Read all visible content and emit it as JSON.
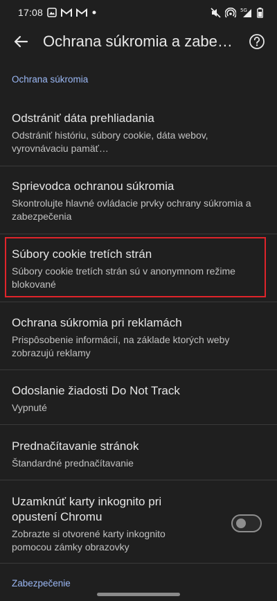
{
  "status_bar": {
    "time": "17:08",
    "signal_label": "5G"
  },
  "app_bar": {
    "title": "Ochrana súkromia a zabezpečenie"
  },
  "sections": {
    "privacy_header": "Ochrana súkromia",
    "security_header": "Zabezpečenie"
  },
  "items": [
    {
      "title": "Odstrániť dáta prehliadania",
      "subtitle": "Odstrániť históriu, súbory cookie, dáta webov, vyrovnávaciu pamäť…"
    },
    {
      "title": "Sprievodca ochranou súkromia",
      "subtitle": "Skontrolujte hlavné ovládacie prvky ochrany súkromia a zabezpečenia"
    },
    {
      "title": "Súbory cookie tretích strán",
      "subtitle": "Súbory cookie tretích strán sú v anonymnom režime blokované"
    },
    {
      "title": "Ochrana súkromia pri reklamách",
      "subtitle": "Prispôsobenie informácií, na základe ktorých weby zobrazujú reklamy"
    },
    {
      "title": "Odoslanie žiadosti Do Not Track",
      "subtitle": "Vypnuté"
    },
    {
      "title": "Prednačítavanie stránok",
      "subtitle": "Štandardné prednačítavanie"
    },
    {
      "title": "Uzamknúť karty inkognito pri opustení Chromu",
      "subtitle": "Zobrazte si otvorené karty inkognito pomocou zámky obrazovky",
      "toggle_on": false
    }
  ],
  "colors": {
    "background": "#1f1f1f",
    "accent": "#9bb8f5",
    "highlight": "#e0242a"
  },
  "icons": {
    "back": "arrow-left-icon",
    "help": "help-circle-icon"
  }
}
